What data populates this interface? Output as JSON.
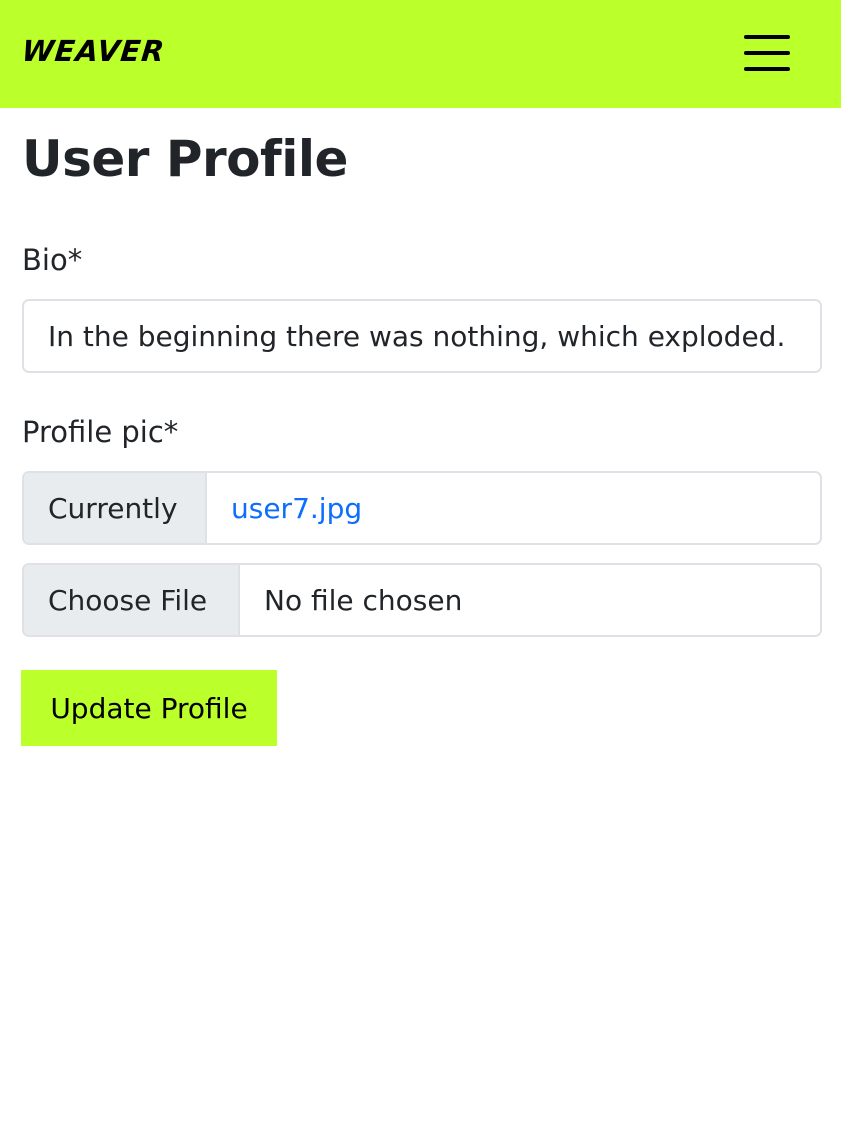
{
  "navbar": {
    "brand": "WEAVER",
    "menu_icon": "hamburger-menu-icon",
    "background": "#bbff2b"
  },
  "page": {
    "title": "User Profile"
  },
  "form": {
    "bio_label": "Bio*",
    "bio_value": "In the beginning there was nothing, which exploded.",
    "pic_label": "Profile pic*",
    "currently_label": "Currently",
    "current_file": "user7.jpg",
    "choose_file_label": "Choose File",
    "file_status": "No file chosen",
    "submit_label": "Update Profile"
  },
  "colors": {
    "accent": "#bbff2b",
    "link": "#0d6efd",
    "addon_bg": "#e9ecef",
    "border": "#dee2e6"
  }
}
